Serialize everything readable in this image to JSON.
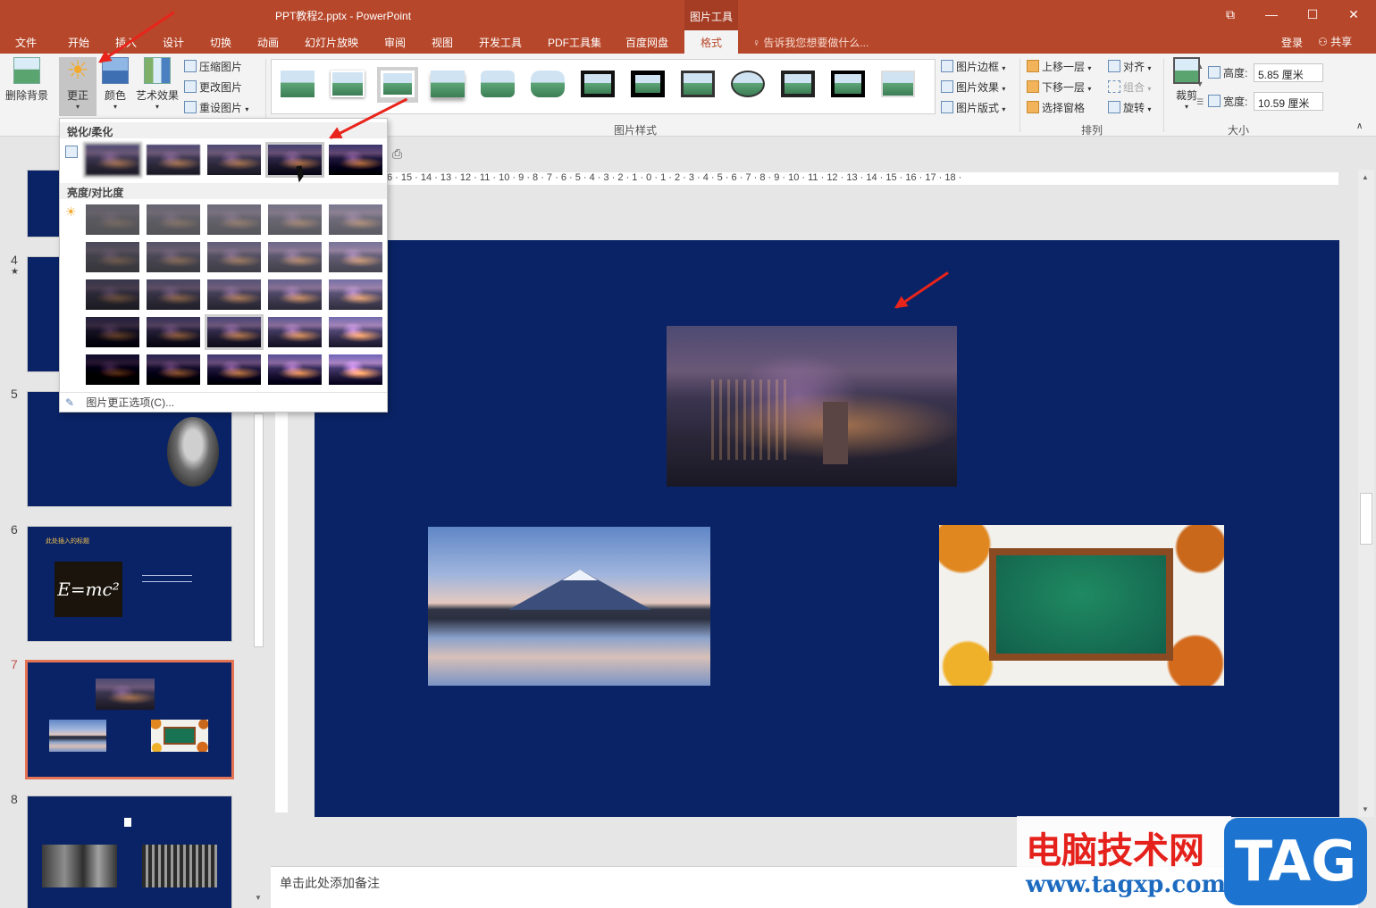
{
  "window": {
    "title": "PPT教程2.pptx - PowerPoint",
    "context_tab_header": "图片工具",
    "controls": [
      "⧉",
      "—",
      "☐",
      "✕"
    ]
  },
  "tabs": [
    "文件",
    "开始",
    "插入",
    "设计",
    "切换",
    "动画",
    "幻灯片放映",
    "审阅",
    "视图",
    "开发工具",
    "PDF工具集",
    "百度网盘"
  ],
  "active_tab": "格式",
  "tell_me": "告诉我您想要做什么...",
  "login": "登录",
  "share": "共享",
  "ribbon": {
    "remove_bg": "删除背景",
    "correct": "更正",
    "color": "颜色",
    "art_effects": "艺术效果",
    "compress": "压缩图片",
    "change": "更改图片",
    "reset": "重设图片",
    "picture_styles_label": "图片样式",
    "border": "图片边框",
    "effects": "图片效果",
    "layout": "图片版式",
    "bring_forward": "上移一层",
    "send_backward": "下移一层",
    "selection_pane": "选择窗格",
    "align": "对齐",
    "group": "组合",
    "rotate": "旋转",
    "arrange_label": "排列",
    "crop": "裁剪",
    "height_label": "高度:",
    "height_value": "5.85 厘米",
    "width_label": "宽度:",
    "width_value": "10.59 厘米",
    "size_label": "大小"
  },
  "dropdown": {
    "sharpen_header": "锐化/柔化",
    "brightness_header": "亮度/对比度",
    "options_link": "图片更正选项(C)..."
  },
  "slides": [
    {
      "num": "4",
      "star": "★"
    },
    {
      "num": "5"
    },
    {
      "num": "6",
      "title": "此处插入的标题",
      "formula": "E=mc²"
    },
    {
      "num": "7"
    },
    {
      "num": "8"
    }
  ],
  "ruler_top": "6 · 15 · 14 · 13 · 12 · 11 · 10 · 9 · 8 · 7 · 6 · 5 · 4 · 3 · 2 · 1 · 0 · 1 · 2 · 3 · 4 · 5 · 6 · 7 · 8 · 9 · 10 · 11 · 12 · 13 · 14 · 15 · 16 · 17 · 18 ·",
  "notes_placeholder": "单击此处添加备注",
  "watermark": {
    "cn": "电脑技术网",
    "url": "www.tagxp.com",
    "tag": "TAG"
  }
}
